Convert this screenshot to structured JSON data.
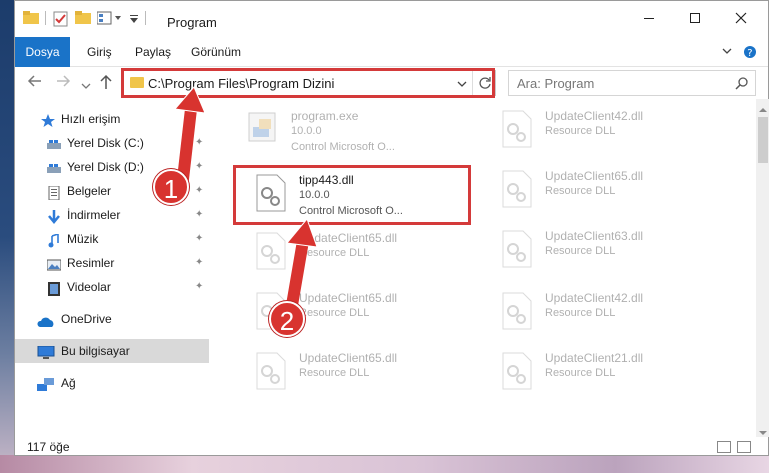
{
  "window": {
    "title": "Program",
    "minimize_icon": "minimize-icon",
    "maximize_icon": "maximize-icon",
    "close_icon": "close-icon"
  },
  "ribbon": {
    "tabs": [
      "Dosya",
      "Giriş",
      "Paylaş",
      "Görünüm"
    ],
    "expand_icon": "chevron-down-icon",
    "help_icon": "help-icon"
  },
  "address_bar": {
    "path": "C:\\Program Files\\Program Dizini",
    "search_placeholder": "Ara: Program"
  },
  "nav": {
    "quick_access": "Hızlı erişim",
    "items": [
      {
        "label": "Yerel Disk (C:)",
        "icon": "drive-icon"
      },
      {
        "label": "Yerel Disk (D:)",
        "icon": "drive-icon"
      },
      {
        "label": "Belgeler",
        "icon": "documents-icon"
      },
      {
        "label": "İndirmeler",
        "icon": "downloads-icon"
      },
      {
        "label": "Müzik",
        "icon": "music-icon"
      },
      {
        "label": "Resimler",
        "icon": "pictures-icon"
      },
      {
        "label": "Videolar",
        "icon": "videos-icon"
      }
    ],
    "onedrive": "OneDrive",
    "this_pc": "Bu bilgisayar",
    "network": "Ağ"
  },
  "files": {
    "left": [
      {
        "name": "program.exe",
        "line1": "10.0.0",
        "line2": "Control Microsoft O..."
      },
      {
        "name": "tipp443.dll",
        "line1": "10.0.0",
        "line2": "Control Microsoft O..."
      },
      {
        "name": "UpdateClient65.dll",
        "line1": "Resource DLL"
      },
      {
        "name": "UpdateClient65.dll",
        "line1": "Resource DLL"
      },
      {
        "name": "UpdateClient65.dll",
        "line1": "Resource DLL"
      }
    ],
    "right": [
      {
        "name": "UpdateClient42.dll",
        "line1": "Resource DLL"
      },
      {
        "name": "UpdateClient65.dll",
        "line1": "Resource DLL"
      },
      {
        "name": "UpdateClient63.dll",
        "line1": "Resource DLL"
      },
      {
        "name": "UpdateClient42.dll",
        "line1": "Resource DLL"
      },
      {
        "name": "UpdateClient21.dll",
        "line1": "Resource DLL"
      }
    ]
  },
  "status": {
    "count": "117 öğe"
  },
  "annotations": {
    "marker1": "1",
    "marker2": "2",
    "highlight_color": "#d43a3a"
  }
}
